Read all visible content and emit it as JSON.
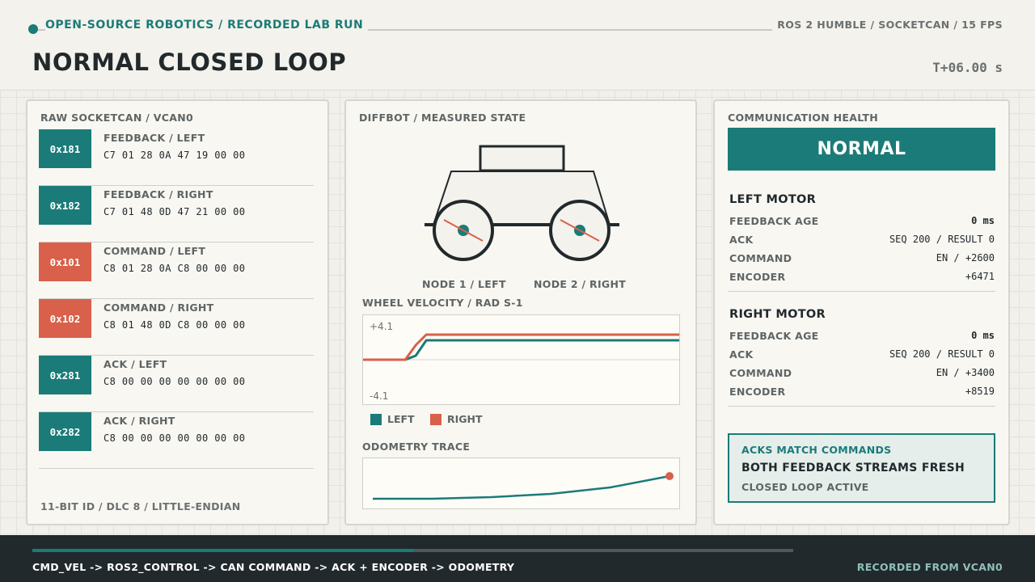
{
  "header": {
    "kicker": "OPEN-SOURCE ROBOTICS / RECORDED LAB RUN",
    "stack": "ROS 2 HUMBLE / SOCKETCAN / 15 FPS",
    "title": "NORMAL CLOSED LOOP",
    "clock": "T+06.00 s"
  },
  "can": {
    "title": "RAW SOCKETCAN / VCAN0",
    "footer": "11-BIT ID / DLC 8 / LITTLE-ENDIAN",
    "frames": [
      {
        "id": "0x181",
        "label": "FEEDBACK / LEFT",
        "bytes": "C7 01 28 0A 47 19 00 00",
        "color": "#1b7b78"
      },
      {
        "id": "0x182",
        "label": "FEEDBACK / RIGHT",
        "bytes": "C7 01 48 0D 47 21 00 00",
        "color": "#1b7b78"
      },
      {
        "id": "0x101",
        "label": "COMMAND / LEFT",
        "bytes": "C8 01 28 0A C8 00 00 00",
        "color": "#d9604a"
      },
      {
        "id": "0x102",
        "label": "COMMAND / RIGHT",
        "bytes": "C8 01 48 0D C8 00 00 00",
        "color": "#d9604a"
      },
      {
        "id": "0x281",
        "label": "ACK / LEFT",
        "bytes": "C8 00 00 00 00 00 00 00",
        "color": "#1b7b78"
      },
      {
        "id": "0x282",
        "label": "ACK / RIGHT",
        "bytes": "C8 00 00 00 00 00 00 00",
        "color": "#1b7b78"
      }
    ]
  },
  "robot": {
    "title": "DIFFBOT / MEASURED STATE",
    "node_left": "NODE 1 / LEFT",
    "node_right": "NODE 2 / RIGHT",
    "velocity_title": "WHEEL VELOCITY / RAD S-1",
    "legend_left": "LEFT",
    "legend_right": "RIGHT",
    "odometry_title": "ODOMETRY TRACE"
  },
  "chart_data": [
    {
      "type": "line",
      "title": "WHEEL VELOCITY / RAD S-1",
      "ylim": [
        -4.1,
        4.1
      ],
      "y_tick_labels": [
        "+4.1",
        "-4.1"
      ],
      "x": [
        0,
        0.8,
        1.0,
        1.2,
        6.0
      ],
      "series": [
        {
          "name": "LEFT",
          "color": "#1b7b78",
          "values": [
            0,
            0,
            0.5,
            2.4,
            2.4
          ]
        },
        {
          "name": "RIGHT",
          "color": "#d9604a",
          "values": [
            0,
            0,
            1.8,
            3.1,
            3.1
          ]
        }
      ]
    },
    {
      "type": "line",
      "title": "ODOMETRY TRACE",
      "series": [
        {
          "name": "",
          "color": "#1b7b78",
          "x": [
            0,
            0.2,
            0.4,
            0.6,
            0.8,
            1.0
          ],
          "y": [
            0,
            0,
            0.05,
            0.15,
            0.35,
            0.7
          ]
        }
      ]
    }
  ],
  "health": {
    "title": "COMMUNICATION HEALTH",
    "status": "NORMAL",
    "left": {
      "title": "LEFT MOTOR",
      "rows": [
        {
          "k": "FEEDBACK AGE",
          "v": "0 ms"
        },
        {
          "k": "ACK",
          "v": "SEQ 200 / RESULT 0"
        },
        {
          "k": "COMMAND",
          "v": "EN / +2600"
        },
        {
          "k": "ENCODER",
          "v": "+6471"
        }
      ]
    },
    "right": {
      "title": "RIGHT MOTOR",
      "rows": [
        {
          "k": "FEEDBACK AGE",
          "v": "0 ms"
        },
        {
          "k": "ACK",
          "v": "SEQ 200 / RESULT 0"
        },
        {
          "k": "COMMAND",
          "v": "EN / +3400"
        },
        {
          "k": "ENCODER",
          "v": "+8519"
        }
      ]
    },
    "summary": {
      "line1": "ACKS MATCH COMMANDS",
      "line2": "BOTH FEEDBACK STREAMS FRESH",
      "line3": "CLOSED LOOP ACTIVE"
    }
  },
  "footer": {
    "pipeline": "CMD_VEL -> ROS2_CONTROL -> CAN COMMAND -> ACK + ENCODER -> ODOMETRY",
    "source": "RECORDED FROM VCAN0",
    "progress": 0.5
  }
}
